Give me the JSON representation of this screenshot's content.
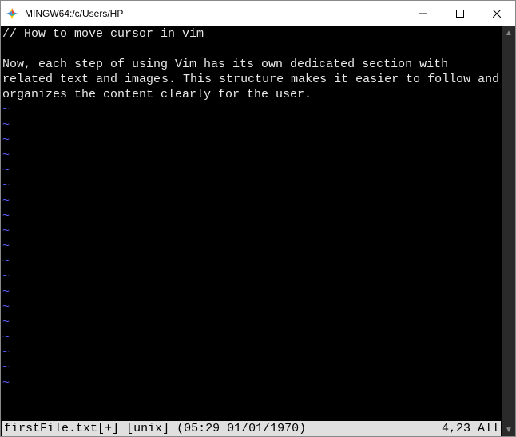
{
  "window": {
    "title": "MINGW64:/c/Users/HP"
  },
  "editor": {
    "line1": "// How to move cursor in vim",
    "line2_a": "Now, each step of using Vim has its own dedicated section with related text and image",
    "line2_b": "s. This structure makes it easier to follow and organizes the content clearly for the user.",
    "tilde": "~"
  },
  "status": {
    "filename": "firstFile.txt",
    "modified": "[+]",
    "format": "[unix]",
    "timestamp": "(05:29 01/01/1970)",
    "position": "4,23",
    "scroll": "All"
  }
}
